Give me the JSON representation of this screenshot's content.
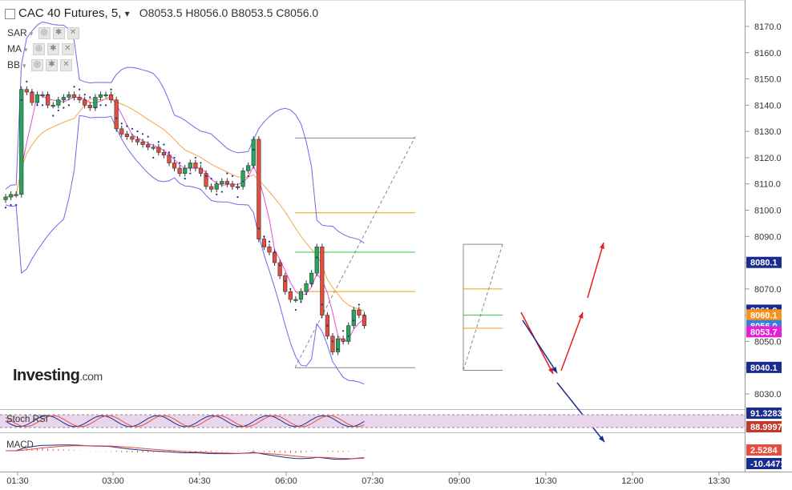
{
  "header": {
    "title": "CAC 40 Futures, 5,",
    "open": "O8053.5",
    "high": "H8056.0",
    "low": "B8053.5",
    "close": "C8056.0"
  },
  "indicators": [
    {
      "label": "SAR"
    },
    {
      "label": "MA"
    },
    {
      "label": "BB"
    }
  ],
  "logo": {
    "main": "Investing",
    "suffix": ".com"
  },
  "price_axis": {
    "ticks": [
      "8170.0",
      "8160.0",
      "8150.0",
      "8140.0",
      "8130.0",
      "8120.0",
      "8110.0",
      "8100.0",
      "8090.0",
      "8080.0",
      "8070.0",
      "8060.0",
      "8050.0",
      "8040.0",
      "8030.0"
    ],
    "badges": [
      {
        "value": "8080.1",
        "color": "#1a2b8f"
      },
      {
        "value": "8061.9",
        "color": "#1a2b8f"
      },
      {
        "value": "8060.1",
        "color": "#f7931a"
      },
      {
        "value": "8056.0",
        "color": "#3b7dd8"
      },
      {
        "value": "8053.7",
        "color": "#e61ed8"
      },
      {
        "value": "8040.1",
        "color": "#1a2b8f"
      }
    ]
  },
  "time_axis": {
    "labels": [
      "01:30",
      "03:00",
      "04:30",
      "06:00",
      "07:30",
      "09:00",
      "10:30",
      "12:00",
      "13:30"
    ]
  },
  "stoch_rsi": {
    "label": "Stoch RSI",
    "values": [
      "91.3283",
      "88.9997"
    ],
    "colors": [
      "#1a2b8f",
      "#c0392b"
    ]
  },
  "macd": {
    "label": "MACD",
    "values": [
      "2.5284",
      "-10.4471"
    ],
    "colors": [
      "#e74c3c",
      "#1a2b8f"
    ]
  },
  "colors": {
    "up": "#26a65b",
    "down": "#e74c3c",
    "bollinger": "#6a6ae8",
    "ma_fast": "#e84ed8",
    "ma_slow": "#f7a540",
    "sar": "#1a2b8f",
    "arrow_red": "#e61e1e",
    "arrow_blue": "#1a2b8f",
    "fib_orange": "#f39c12",
    "fib_green": "#2ecc40"
  },
  "chart_data": {
    "type": "candlestick",
    "series": [
      {
        "name": "close_path",
        "values": [
          8105,
          8106,
          8106,
          8146,
          8145,
          8141,
          8144,
          8144,
          8140,
          8140,
          8142,
          8143,
          8144,
          8143,
          8142,
          8140,
          8139,
          8143,
          8144,
          8144,
          8142,
          8131,
          8129,
          8128,
          8127,
          8126,
          8125,
          8124,
          8124,
          8122,
          8121,
          8118,
          8116,
          8114,
          8116,
          8118,
          8116,
          8114,
          8109,
          8108,
          8110,
          8111,
          8110,
          8109,
          8109,
          8115,
          8117,
          8127,
          8089,
          8086,
          8084,
          8080,
          8075,
          8069,
          8066,
          8066,
          8069,
          8072,
          8076,
          8086,
          8060,
          8052,
          8046,
          8051,
          8050,
          8056,
          8062,
          8060,
          8056
        ]
      }
    ],
    "ylim": [
      8030,
      8175
    ]
  }
}
